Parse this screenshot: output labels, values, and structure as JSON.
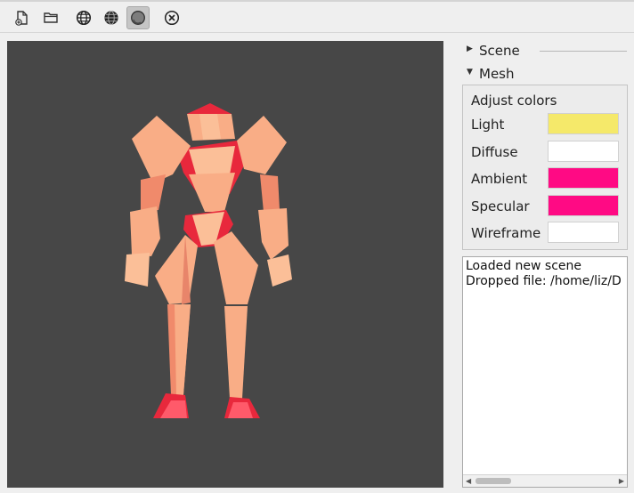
{
  "toolbar": {
    "buttons": [
      {
        "name": "new-file-icon"
      },
      {
        "name": "open-folder-icon"
      },
      {
        "name": "wireframe-globe-icon"
      },
      {
        "name": "solid-globe-icon"
      },
      {
        "name": "shaded-sphere-icon",
        "checked": true
      },
      {
        "name": "close-circle-icon"
      }
    ]
  },
  "sidebar": {
    "scene_label": "Scene",
    "mesh_label": "Mesh",
    "adjust_colors_label": "Adjust colors",
    "colors": [
      {
        "label": "Light",
        "color": "#f5e96a"
      },
      {
        "label": "Diffuse",
        "color": "#ffffff"
      },
      {
        "label": "Ambient",
        "color": "#ff0a84"
      },
      {
        "label": "Specular",
        "color": "#ff0a84"
      },
      {
        "label": "Wireframe",
        "color": "#ffffff"
      }
    ]
  },
  "log": {
    "lines": [
      "Loaded new scene",
      "Dropped file: /home/liz/D"
    ]
  },
  "viewport": {
    "background": "#474747",
    "model_colors": {
      "light": "#f9ad86",
      "mid": "#f08a6b",
      "dark": "#e8283c"
    }
  }
}
